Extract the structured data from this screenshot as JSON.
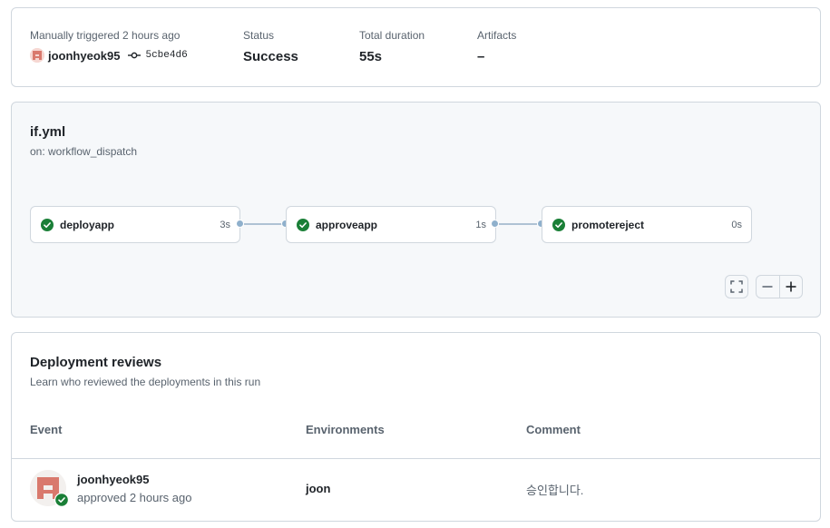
{
  "summary": {
    "trigger_label": "Manually triggered 2 hours ago",
    "actor": "joonhyeok95",
    "commit_sha": "5cbe4d6",
    "status_label": "Status",
    "status_value": "Success",
    "duration_label": "Total duration",
    "duration_value": "55s",
    "artifacts_label": "Artifacts",
    "artifacts_value": "–"
  },
  "workflow": {
    "file": "if.yml",
    "trigger": "on: workflow_dispatch",
    "jobs": [
      {
        "name": "deployapp",
        "duration": "3s",
        "status": "success"
      },
      {
        "name": "approveapp",
        "duration": "1s",
        "status": "success"
      },
      {
        "name": "promotereject",
        "duration": "0s",
        "status": "success"
      }
    ],
    "controls": [
      "fullscreen-icon",
      "zoom-out-icon",
      "zoom-in-icon"
    ]
  },
  "reviews": {
    "title": "Deployment reviews",
    "subtitle": "Learn who reviewed the deployments in this run",
    "columns": [
      "Event",
      "Environments",
      "Comment"
    ],
    "rows": [
      {
        "reviewer": "joonhyeok95",
        "event": "approved 2 hours ago",
        "environment": "joon",
        "comment": "승인합니다."
      }
    ]
  },
  "colors": {
    "success": "#1a7f37",
    "border": "#d0d7de",
    "muted_text": "#59636e",
    "graph_bg": "#f6f8fa",
    "connector": "#afc2d4",
    "avatar": "#d9796d"
  }
}
